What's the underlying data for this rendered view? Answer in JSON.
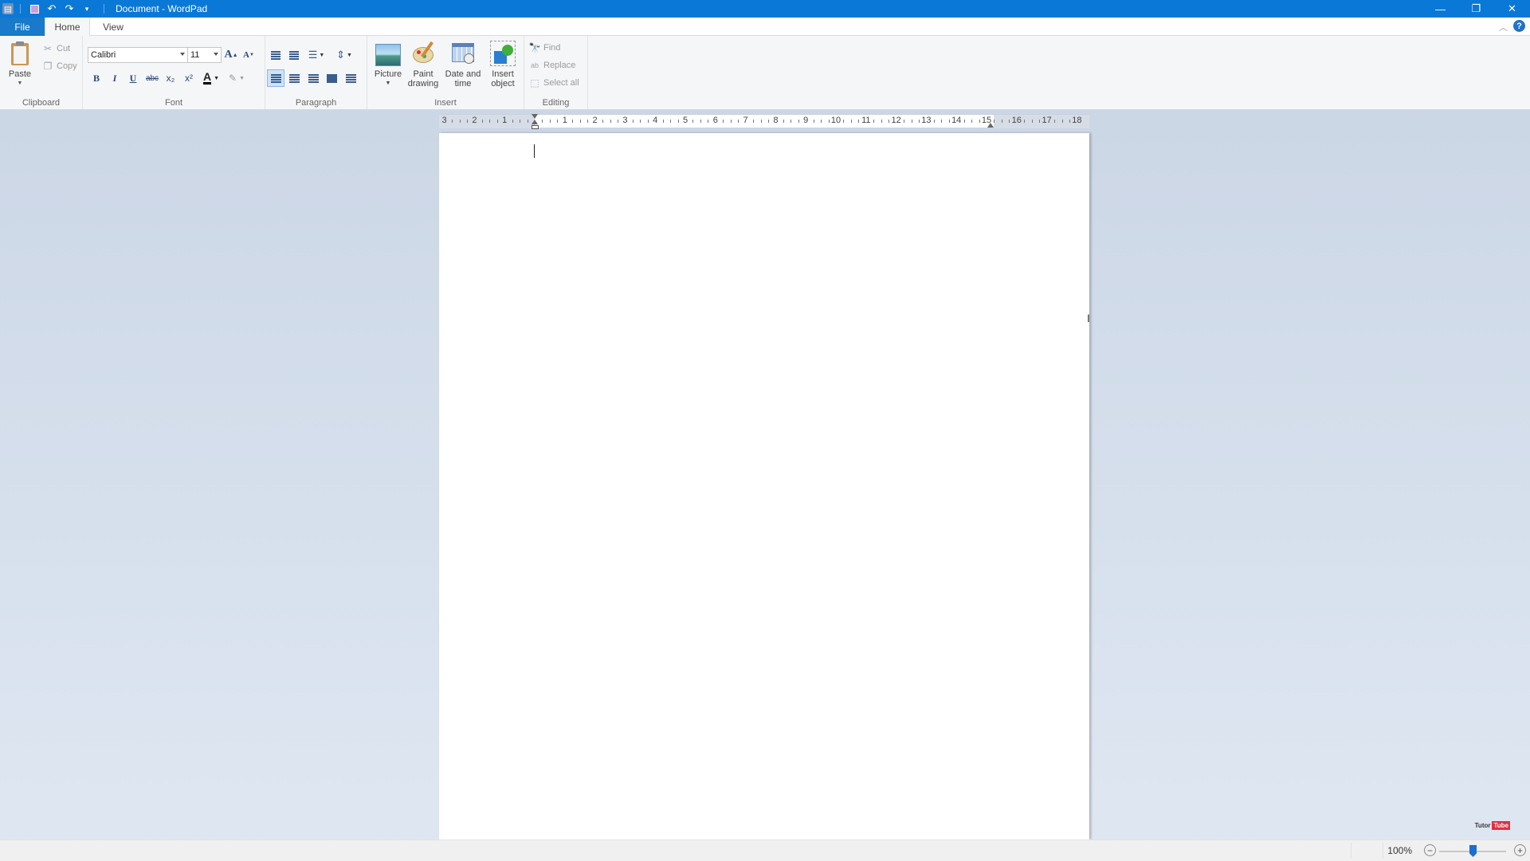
{
  "window": {
    "title": "Document - WordPad",
    "controls": {
      "minimize": "—",
      "restore": "❐",
      "close": "✕"
    }
  },
  "quick_access": {
    "save_icon": "save-icon",
    "undo_icon": "undo-icon",
    "redo_icon": "redo-icon",
    "customize_icon": "customize-icon"
  },
  "tabs": [
    {
      "label": "File"
    },
    {
      "label": "Home"
    },
    {
      "label": "View"
    }
  ],
  "ribbon": {
    "clipboard": {
      "label": "Clipboard",
      "paste": "Paste",
      "cut": "Cut",
      "copy": "Copy"
    },
    "font": {
      "label": "Font",
      "family": "Calibri",
      "size": "11",
      "bold": "B",
      "italic": "I",
      "underline": "U",
      "strike": "abc",
      "subscript": "x₂",
      "superscript": "x²",
      "grow": "A",
      "shrink": "A",
      "color": "A"
    },
    "paragraph": {
      "label": "Paragraph",
      "active_alignment": "left"
    },
    "insert": {
      "label": "Insert",
      "picture": "Picture",
      "paint_line1": "Paint",
      "paint_line2": "drawing",
      "date_line1": "Date and",
      "date_line2": "time",
      "object_line1": "Insert",
      "object_line2": "object"
    },
    "editing": {
      "label": "Editing",
      "find": "Find",
      "replace": "Replace",
      "select_all": "Select all"
    }
  },
  "ruler": {
    "left_labels": [
      "3",
      "2",
      "1"
    ],
    "right_labels": [
      "1",
      "2",
      "3",
      "4",
      "5",
      "6",
      "7",
      "8",
      "9",
      "10",
      "11",
      "12",
      "13",
      "14",
      "15",
      "16",
      "17",
      "18"
    ]
  },
  "document": {
    "content": ""
  },
  "statusbar": {
    "zoom": "100%",
    "zoom_minus": "−",
    "zoom_plus": "+",
    "zoom_level_percent": 100
  },
  "watermark": {
    "text1": "Tutor",
    "text2": "Tube"
  }
}
